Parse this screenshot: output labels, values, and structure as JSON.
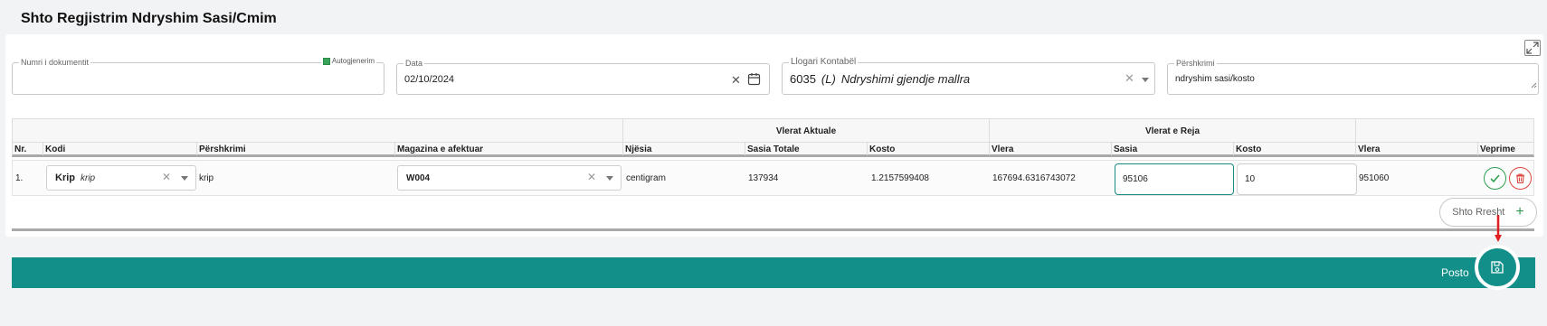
{
  "page": {
    "title": "Shto Regjistrim Ndryshim Sasi/Cmim"
  },
  "form": {
    "doc_number": {
      "label": "Numri i dokumentit",
      "value": "",
      "autogen_label": "Autogjenerim",
      "autogen_checked": true
    },
    "date": {
      "label": "Data",
      "value": "02/10/2024"
    },
    "account": {
      "label": "Llogari Kontabël",
      "code": "6035",
      "type": "(L)",
      "name": "Ndryshimi gjendje mallra"
    },
    "description": {
      "label": "Përshkrimi",
      "value": "ndryshim sasi/kosto"
    }
  },
  "table": {
    "groups": {
      "current": "Vlerat Aktuale",
      "new": "Vlerat e Reja"
    },
    "columns": {
      "nr": "Nr.",
      "code": "Kodi",
      "desc": "Përshkrimi",
      "warehouse": "Magazina e afektuar",
      "unit": "Njësia",
      "total_qty": "Sasia Totale",
      "cost": "Kosto",
      "value": "Vlera",
      "new_qty": "Sasia",
      "new_cost": "Kosto",
      "new_value": "Vlera",
      "actions": "Veprime"
    },
    "rows": [
      {
        "nr": "1.",
        "code": "Krip",
        "code_desc": "krip",
        "desc": "krip",
        "warehouse": "W004",
        "unit": "centigram",
        "total_qty": "137934",
        "cost": "1.2157599408",
        "value": "167694.6316743072",
        "new_qty": "95106",
        "new_cost": "10",
        "new_value": "951060"
      }
    ]
  },
  "buttons": {
    "add_row": "Shto Rresht",
    "post": "Posto"
  },
  "colors": {
    "primary": "#128f89",
    "success": "#2e9e4f",
    "danger": "#d9473e"
  }
}
